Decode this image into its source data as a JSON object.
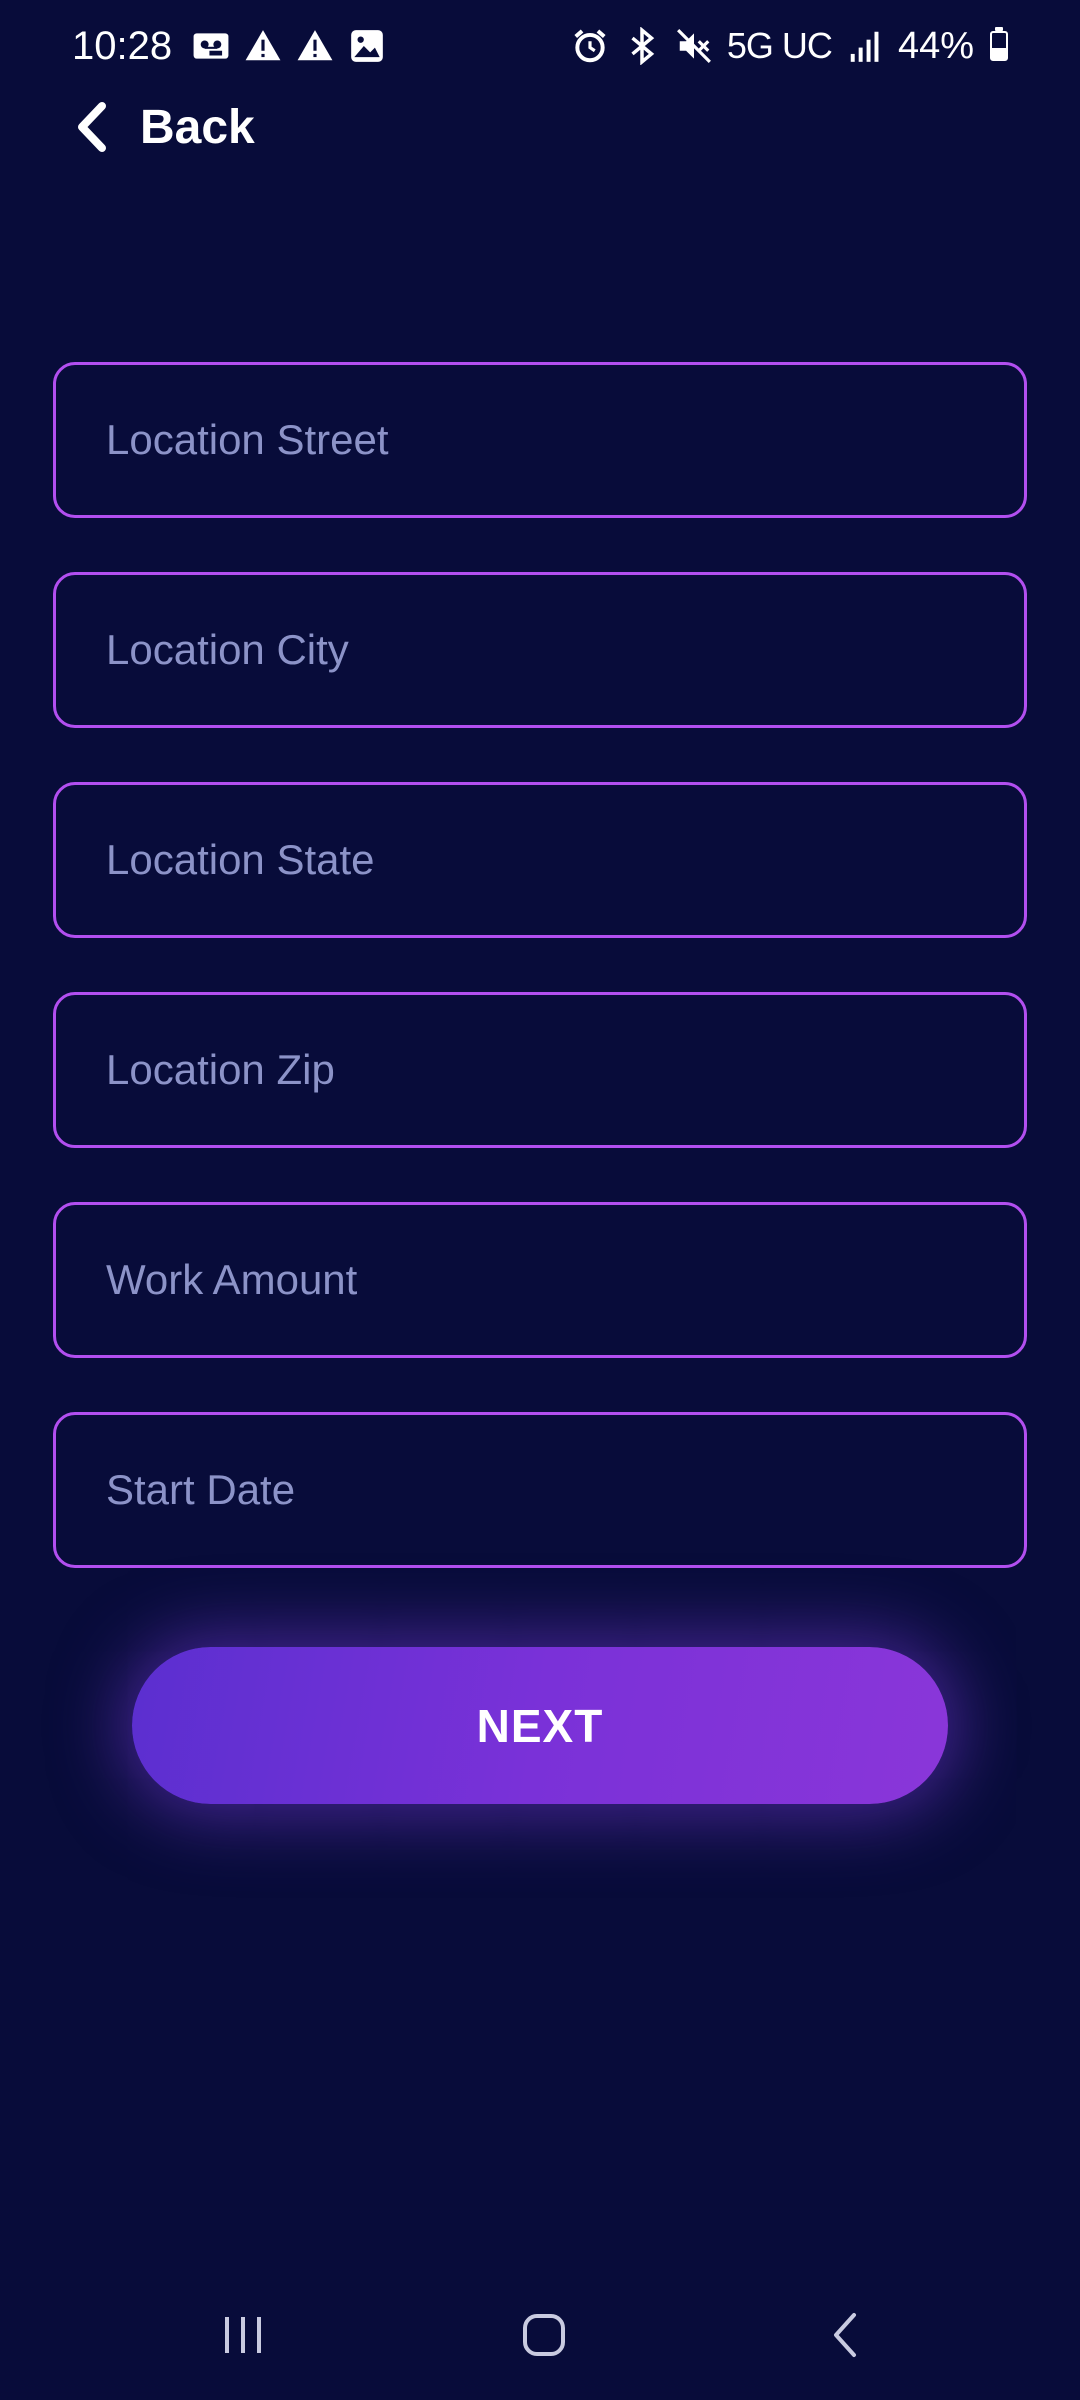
{
  "status_bar": {
    "time": "10:28",
    "network": "5G UC",
    "battery": "44%",
    "battery_level": 0.44,
    "left_icons": [
      "voicemail-icon",
      "warning-icon",
      "warning-icon",
      "image-icon"
    ],
    "right_icons": [
      "alarm-icon",
      "bluetooth-icon",
      "mute-icon",
      "signal-icon",
      "battery-icon"
    ]
  },
  "header": {
    "back_label": "Back",
    "back_icon": "chevron-left-icon"
  },
  "form": {
    "fields": [
      {
        "placeholder": "Location Street",
        "value": ""
      },
      {
        "placeholder": "Location City",
        "value": ""
      },
      {
        "placeholder": "Location State",
        "value": ""
      },
      {
        "placeholder": "Location Zip",
        "value": ""
      },
      {
        "placeholder": "Work Amount",
        "value": ""
      },
      {
        "placeholder": "Start Date",
        "value": ""
      }
    ]
  },
  "next_button": {
    "label": "NEXT"
  },
  "nav_bar": {
    "items": [
      "recents-icon",
      "home-icon",
      "back-nav-icon"
    ]
  },
  "colors": {
    "background": "#080c3a",
    "field_border": "#b24ff0",
    "placeholder": "#8c93c8",
    "button_gradient_start": "#5b2fd0",
    "button_gradient_end": "#8a36d9"
  }
}
